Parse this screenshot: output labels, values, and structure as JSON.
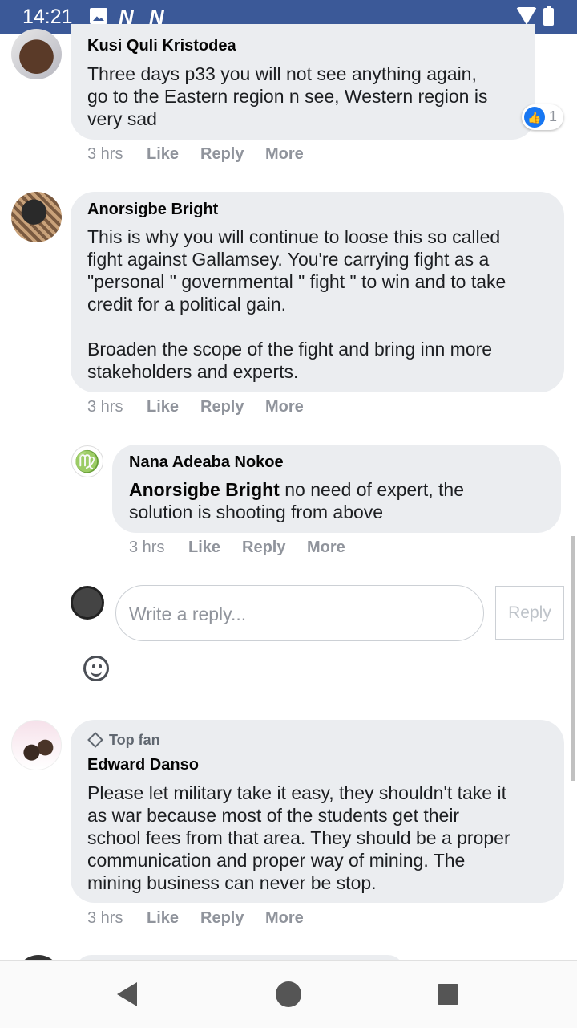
{
  "status_bar": {
    "time": "14:21",
    "n1": "N",
    "n2": "N"
  },
  "comments": [
    {
      "author": "Kusi Quli Kristodea",
      "text": "Three days p33 you will not see anything again,\ngo to the Eastern region n see, Western region is\nvery sad",
      "time": "3 hrs",
      "like": "Like",
      "reply": "Reply",
      "more": "More",
      "reaction_count": "1"
    },
    {
      "author": "Anorsigbe Bright",
      "text": "This is why you will continue to loose this so called\nfight against Gallamsey. You're carrying fight as a\n\"personal \" governmental \" fight \" to win and to take\ncredit for a political gain.\n\nBroaden the scope of the fight and bring inn more\nstakeholders and experts.",
      "time": "3 hrs",
      "like": "Like",
      "reply": "Reply",
      "more": "More"
    },
    {
      "author": "Nana Adeaba Nokoe",
      "mention": "Anorsigbe Bright",
      "text": " no need of expert, the\nsolution is shooting from above",
      "time": "3 hrs",
      "like": "Like",
      "reply": "Reply",
      "more": "More",
      "avatar_glyph": "♍"
    },
    {
      "badge": "Top fan",
      "author": "Edward Danso",
      "text": "Please let military take it easy, they shouldn't take it\nas war because most of the students get their\nschool fees from that area. They should be a proper\ncommunication and proper way of mining. The\nmining business can never be stop.",
      "time": "3 hrs",
      "like": "Like",
      "reply": "Reply",
      "more": "More"
    }
  ],
  "reply_box": {
    "placeholder": "Write a reply...",
    "button": "Reply"
  },
  "icons": {
    "like": "thumbs-up-icon",
    "emoji": "smiley-icon",
    "badge": "diamond-icon",
    "nav": [
      "back-icon",
      "home-icon",
      "recents-icon"
    ]
  },
  "colors": {
    "status_bar": "#3b5998",
    "bubble": "#ebedf0",
    "like_blue": "#1877f2",
    "meta": "#90949c"
  }
}
